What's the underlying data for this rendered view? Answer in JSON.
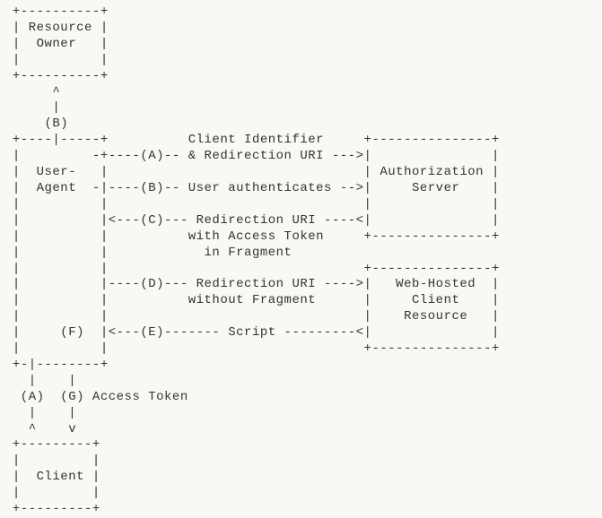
{
  "diagram": {
    "lines": [
      " +----------+",
      " | Resource |",
      " |  Owner   |",
      " |          |",
      " +----------+",
      "      ^",
      "      |",
      "     (B)",
      " +----|-----+          Client Identifier     +---------------+",
      " |         -+----(A)-- & Redirection URI --->|               |",
      " |  User-   |                                | Authorization |",
      " |  Agent  -|----(B)-- User authenticates -->|     Server    |",
      " |          |                                |               |",
      " |          |<---(C)--- Redirection URI ----<|               |",
      " |          |          with Access Token     +---------------+",
      " |          |            in Fragment",
      " |          |                                +---------------+",
      " |          |----(D)--- Redirection URI ---->|   Web-Hosted  |",
      " |          |          without Fragment      |     Client    |",
      " |          |                                |    Resource   |",
      " |     (F)  |<---(E)------- Script ---------<|               |",
      " |          |                                +---------------+",
      " +-|--------+",
      "   |    |",
      "  (A)  (G) Access Token",
      "   |    |",
      "   ^    v",
      " +---------+",
      " |         |",
      " |  Client |",
      " |         |",
      " +---------+"
    ]
  },
  "entities": {
    "resource_owner": "Resource Owner",
    "user_agent": "User-Agent",
    "authorization_server": "Authorization Server",
    "web_hosted_client_resource": "Web-Hosted Client Resource",
    "client": "Client"
  },
  "flows": {
    "A": "Client Identifier & Redirection URI",
    "B": "User authenticates",
    "C": "Redirection URI with Access Token in Fragment",
    "D": "Redirection URI without Fragment",
    "E": "Script",
    "F": "",
    "G": "Access Token"
  }
}
